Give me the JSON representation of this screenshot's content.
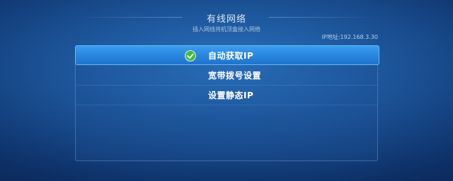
{
  "header": {
    "title": "有线网络",
    "subtitle": "插入网线将机顶盒接入网络",
    "ip_address": "IP地址:192.168.3.30"
  },
  "menu": {
    "items": [
      {
        "label": "自动获取IP",
        "selected": true,
        "icon": "check-circle-icon"
      },
      {
        "label": "宽带拨号设置",
        "selected": false
      },
      {
        "label": "设置静态IP",
        "selected": false
      }
    ]
  },
  "colors": {
    "selected_bg": "#2a86df",
    "check_green": "#3fbf3f",
    "background": "#1a4f92"
  }
}
